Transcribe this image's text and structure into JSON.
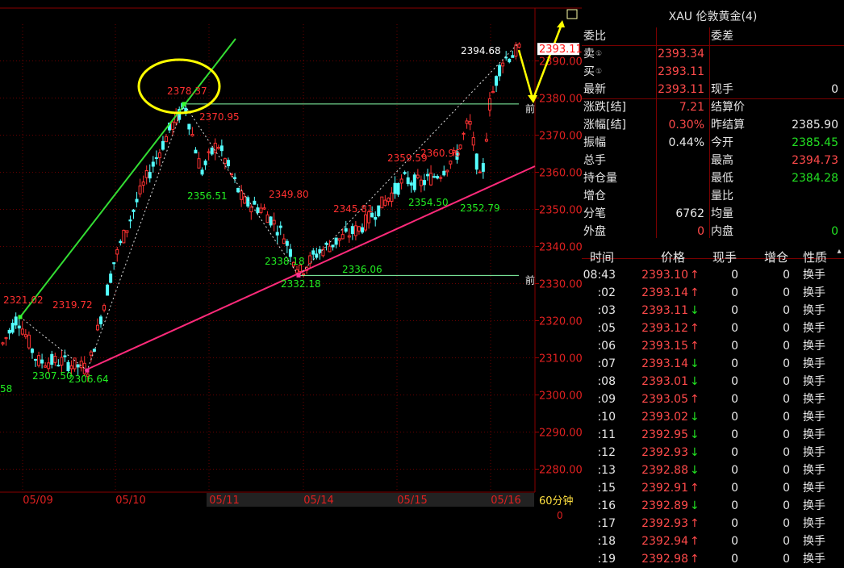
{
  "quote": {
    "title": "XAU 伦敦黄金(4)",
    "rows": [
      [
        {
          "t": "委比",
          "c": "lbl"
        },
        {
          "t": "",
          "c": "red"
        },
        {
          "t": "委差",
          "c": "lbl"
        },
        {
          "t": "",
          "c": "white"
        }
      ],
      [
        {
          "t": "卖",
          "c": "lbl",
          "dot": "①"
        },
        {
          "t": "2393.34",
          "c": "red"
        },
        {
          "t": "",
          "c": "lbl"
        },
        {
          "t": "",
          "c": "white"
        }
      ],
      [
        {
          "t": "买",
          "c": "lbl",
          "dot": "①"
        },
        {
          "t": "2393.11",
          "c": "red"
        },
        {
          "t": "",
          "c": "lbl"
        },
        {
          "t": "",
          "c": "white"
        }
      ],
      [
        {
          "t": "最新",
          "c": "lbl"
        },
        {
          "t": "2393.11",
          "c": "red"
        },
        {
          "t": "现手",
          "c": "lbl"
        },
        {
          "t": "0",
          "c": "white"
        }
      ],
      [
        {
          "t": "涨跌[结]",
          "c": "lbl"
        },
        {
          "t": "7.21",
          "c": "red"
        },
        {
          "t": "结算价",
          "c": "lbl"
        },
        {
          "t": "",
          "c": "white"
        }
      ],
      [
        {
          "t": "涨幅[结]",
          "c": "lbl"
        },
        {
          "t": "0.30%",
          "c": "red"
        },
        {
          "t": "昨结算",
          "c": "lbl"
        },
        {
          "t": "2385.90",
          "c": "white"
        }
      ],
      [
        {
          "t": "振幅",
          "c": "lbl"
        },
        {
          "t": "0.44%",
          "c": "white"
        },
        {
          "t": "今开",
          "c": "lbl"
        },
        {
          "t": "2385.45",
          "c": "green"
        }
      ],
      [
        {
          "t": "总手",
          "c": "lbl"
        },
        {
          "t": "",
          "c": "white"
        },
        {
          "t": "最高",
          "c": "lbl"
        },
        {
          "t": "2394.73",
          "c": "red"
        }
      ],
      [
        {
          "t": "持仓量",
          "c": "lbl"
        },
        {
          "t": "",
          "c": "white"
        },
        {
          "t": "最低",
          "c": "lbl"
        },
        {
          "t": "2384.28",
          "c": "green"
        }
      ],
      [
        {
          "t": "增仓",
          "c": "lbl"
        },
        {
          "t": "",
          "c": "white"
        },
        {
          "t": "量比",
          "c": "lbl"
        },
        {
          "t": "",
          "c": "white"
        }
      ],
      [
        {
          "t": "分笔",
          "c": "lbl"
        },
        {
          "t": "6762",
          "c": "white"
        },
        {
          "t": "均量",
          "c": "lbl"
        },
        {
          "t": "",
          "c": "white"
        }
      ],
      [
        {
          "t": "外盘",
          "c": "lbl"
        },
        {
          "t": "0",
          "c": "red"
        },
        {
          "t": "内盘",
          "c": "lbl"
        },
        {
          "t": "0",
          "c": "green"
        }
      ]
    ]
  },
  "ticks": {
    "headers": [
      "时间",
      "价格",
      "现手",
      "增仓",
      "性质"
    ],
    "rows": [
      {
        "time": "08:43",
        "price": "2393.10",
        "arrow": "↑",
        "vol": "0",
        "oi": "0",
        "type": "换手"
      },
      {
        "time": ":02",
        "price": "2393.14",
        "arrow": "↑",
        "vol": "0",
        "oi": "0",
        "type": "换手"
      },
      {
        "time": ":03",
        "price": "2393.11",
        "arrow": "↓",
        "vol": "0",
        "oi": "0",
        "type": "换手"
      },
      {
        "time": ":05",
        "price": "2393.12",
        "arrow": "↑",
        "vol": "0",
        "oi": "0",
        "type": "换手"
      },
      {
        "time": ":06",
        "price": "2393.15",
        "arrow": "↑",
        "vol": "0",
        "oi": "0",
        "type": "换手"
      },
      {
        "time": ":07",
        "price": "2393.14",
        "arrow": "↓",
        "vol": "0",
        "oi": "0",
        "type": "换手"
      },
      {
        "time": ":08",
        "price": "2393.01",
        "arrow": "↓",
        "vol": "0",
        "oi": "0",
        "type": "换手"
      },
      {
        "time": ":09",
        "price": "2393.05",
        "arrow": "↑",
        "vol": "0",
        "oi": "0",
        "type": "换手"
      },
      {
        "time": ":10",
        "price": "2393.02",
        "arrow": "↓",
        "vol": "0",
        "oi": "0",
        "type": "换手"
      },
      {
        "time": ":11",
        "price": "2392.95",
        "arrow": "↓",
        "vol": "0",
        "oi": "0",
        "type": "换手"
      },
      {
        "time": ":12",
        "price": "2392.93",
        "arrow": "↓",
        "vol": "0",
        "oi": "0",
        "type": "换手"
      },
      {
        "time": ":13",
        "price": "2392.88",
        "arrow": "↓",
        "vol": "0",
        "oi": "0",
        "type": "换手"
      },
      {
        "time": ":15",
        "price": "2392.91",
        "arrow": "↑",
        "vol": "0",
        "oi": "0",
        "type": "换手"
      },
      {
        "time": ":16",
        "price": "2392.89",
        "arrow": "↓",
        "vol": "0",
        "oi": "0",
        "type": "换手"
      },
      {
        "time": ":17",
        "price": "2392.93",
        "arrow": "↑",
        "vol": "0",
        "oi": "0",
        "type": "换手"
      },
      {
        "time": ":18",
        "price": "2392.94",
        "arrow": "↑",
        "vol": "0",
        "oi": "0",
        "type": "换手"
      },
      {
        "time": ":19",
        "price": "2392.98",
        "arrow": "↑",
        "vol": "0",
        "oi": "0",
        "type": "换手"
      }
    ]
  },
  "chart": {
    "period": "60分钟",
    "volume_label": "0",
    "current_price": "2393.11",
    "price_marker": "前",
    "colors": {
      "up": "#ff3232",
      "down": "#54ffff",
      "grid": "#6a0000",
      "trend_up": "#33dd33",
      "trend_support": "#ff2a7a",
      "highlight": "#ffff00"
    },
    "y_ticks": [
      "2390.00",
      "2380.00",
      "2370.00",
      "2360.00",
      "2350.00",
      "2340.00",
      "2330.00",
      "2320.00",
      "2310.00",
      "2300.00",
      "2290.00",
      "2280.00"
    ],
    "x_ticks": [
      "05/09",
      "05/10",
      "05/11",
      "05/14",
      "05/15",
      "05/16"
    ],
    "annotations": [
      {
        "text": "2321.02",
        "color": "red"
      },
      {
        "text": "2319.72",
        "color": "red"
      },
      {
        "text": "2307.50",
        "color": "green"
      },
      {
        "text": "2306.64",
        "color": "green"
      },
      {
        "text": "2378.37",
        "color": "red"
      },
      {
        "text": "2370.95",
        "color": "red"
      },
      {
        "text": "2356.51",
        "color": "green"
      },
      {
        "text": "2349.80",
        "color": "red"
      },
      {
        "text": "2338.18",
        "color": "green"
      },
      {
        "text": "2332.18",
        "color": "green"
      },
      {
        "text": "2345.81",
        "color": "red"
      },
      {
        "text": "2336.06",
        "color": "green"
      },
      {
        "text": "2359.59",
        "color": "red"
      },
      {
        "text": "2360.96",
        "color": "red"
      },
      {
        "text": "2354.50",
        "color": "green"
      },
      {
        "text": "2352.79",
        "color": "green"
      },
      {
        "text": "2394.68",
        "color": "white"
      },
      {
        "text": "58",
        "color": "green"
      }
    ]
  }
}
